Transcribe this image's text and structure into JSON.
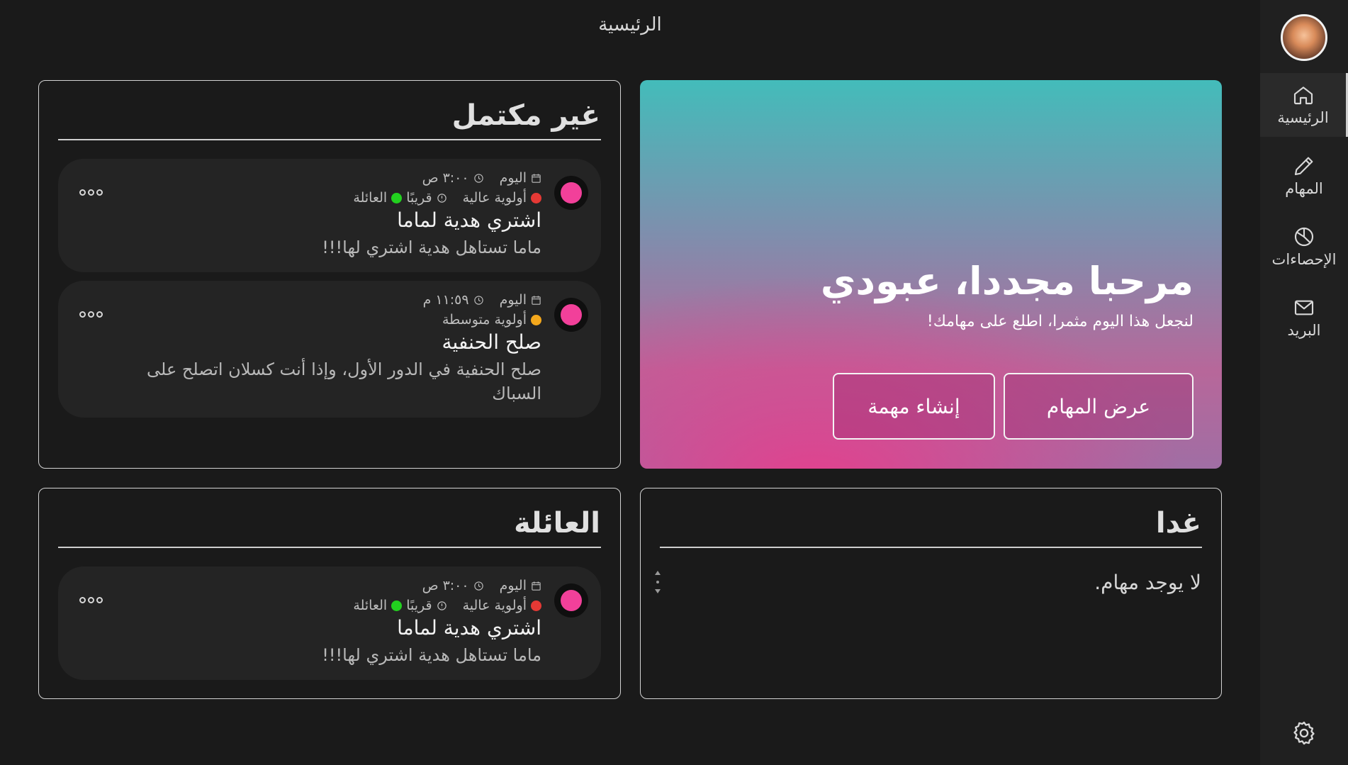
{
  "header": {
    "title": "الرئيسية"
  },
  "sidebar": {
    "items": [
      {
        "label": "الرئيسية",
        "icon": "home-icon",
        "active": true
      },
      {
        "label": "المهام",
        "icon": "pencil-icon"
      },
      {
        "label": "الإحصاءات",
        "icon": "pie-chart-icon"
      },
      {
        "label": "البريد",
        "icon": "mail-icon"
      }
    ],
    "settings_icon": "gear-icon"
  },
  "hero": {
    "title": "مرحبا مجددا، عبودي",
    "subtitle": "لنجعل هذا اليوم مثمرا، اطلع على مهامك!",
    "view_tasks_label": "عرض المهام",
    "create_task_label": "إنشاء مهمة"
  },
  "incomplete": {
    "title": "غير مكتمل",
    "tasks": [
      {
        "date": "اليوم",
        "time": "٣:٠٠ ص",
        "priority": "أولوية عالية",
        "priority_color": "#e53935",
        "due": "قريبًا",
        "category": "العائلة",
        "category_color": "#22d11f",
        "title": "اشتري هدية لماما",
        "description": "ماما تستاهل هدية اشتري لها!!!"
      },
      {
        "date": "اليوم",
        "time": "١١:٥٩ م",
        "priority": "أولوية متوسطة",
        "priority_color": "#f4a81c",
        "title": "صلح الحنفية",
        "description": "صلح الحنفية في الدور الأول، وإذا أنت كسلان اتصلح على السباك"
      }
    ]
  },
  "tomorrow": {
    "title": "غدا",
    "empty_text": "لا يوجد مهام."
  },
  "family": {
    "title": "العائلة",
    "tasks": [
      {
        "date": "اليوم",
        "time": "٣:٠٠ ص",
        "priority": "أولوية عالية",
        "priority_color": "#e53935",
        "due": "قريبًا",
        "category": "العائلة",
        "category_color": "#22d11f",
        "title": "اشتري هدية لماما",
        "description": "ماما تستاهل هدية اشتري لها!!!"
      }
    ]
  },
  "colors": {
    "accent_pink": "#f2409a",
    "background": "#1a1a1a",
    "card_bg": "#242424"
  }
}
